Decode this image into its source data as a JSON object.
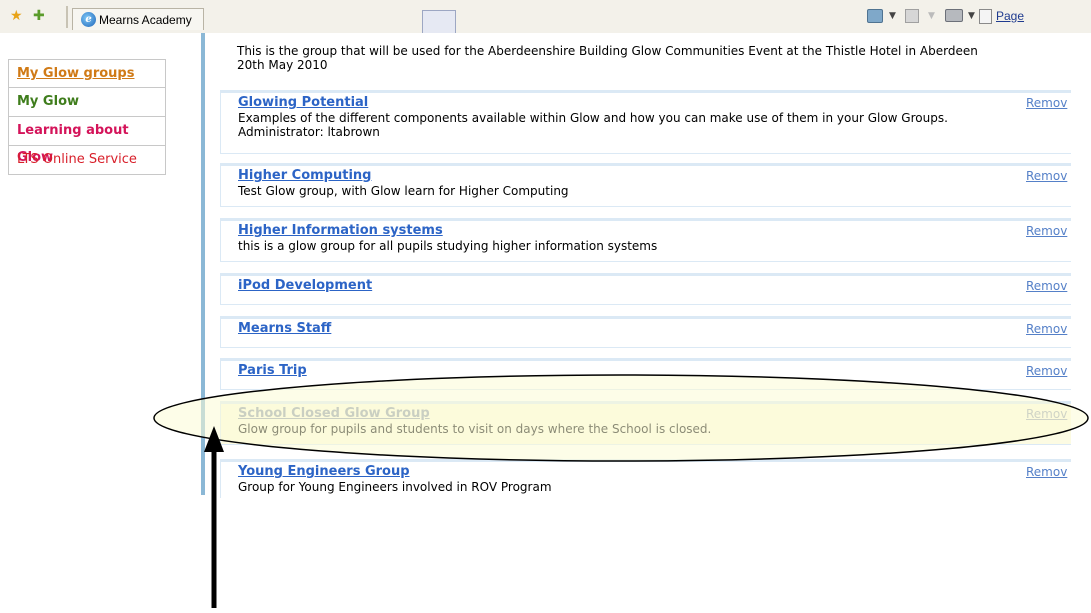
{
  "browser": {
    "tab_title": "Mearns Academy",
    "page_menu_label": "Page"
  },
  "nav": {
    "items": [
      {
        "label": "My Glow groups"
      },
      {
        "label": "My Glow"
      },
      {
        "label": "Learning about Glow"
      },
      {
        "label": "LTS Online Service"
      }
    ]
  },
  "intro": {
    "text_line1": "This is the group that will be used for the Aberdeenshire Building Glow Communities Event at the Thistle Hotel in Aberdeen",
    "text_line2": "20th May 2010"
  },
  "groups": [
    {
      "title": "Glowing Potential",
      "remove": "Remov",
      "desc_line1": "Examples of the different components available within Glow and how you can make use of them in your Glow Groups.",
      "desc_line2": "Administrator: ltabrown"
    },
    {
      "title": "Higher Computing",
      "remove": "Remov",
      "desc_line1": "Test Glow group, with Glow learn for Higher Computing"
    },
    {
      "title": "Higher Information systems",
      "remove": "Remov",
      "desc_line1": "this is a glow group for all pupils studying higher information systems"
    },
    {
      "title": "iPod Development",
      "remove": "Remov"
    },
    {
      "title": "Mearns Staff",
      "remove": "Remov"
    },
    {
      "title": "Paris Trip",
      "remove": "Remov"
    },
    {
      "title": "School Closed Glow Group",
      "remove": "Remov",
      "desc_line1": "Glow group for pupils and students to visit on days where the School is closed.",
      "highlighted": true
    },
    {
      "title": "Young Engineers Group",
      "remove": "Remov",
      "desc_line1": "Group for Young Engineers involved in ROV Program"
    }
  ],
  "colors": {
    "link": "#2c64c6",
    "highlight_fill": "#fcfbe3",
    "divider": "#8bb8d6"
  },
  "annotation": {
    "shape": "ellipse-around-group",
    "pointer": "arrow-up"
  }
}
